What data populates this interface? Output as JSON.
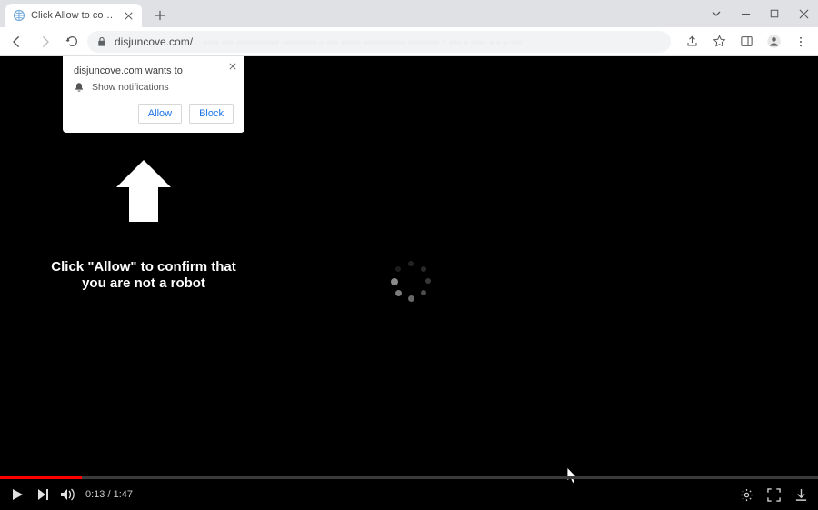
{
  "window": {
    "tab_title": "Click Allow to confirm that you a",
    "url_host": "disjuncove.com/",
    "url_tail_blur": "···· ··· ··········· ········· · ··· ····· ··········· ········ · ··· · ···· · · · ···"
  },
  "notification": {
    "title": "disjuncove.com wants to",
    "permission_text": "Show notifications",
    "allow_label": "Allow",
    "block_label": "Block"
  },
  "page": {
    "instruction_text": "Click \"Allow\" to confirm that you are not a robot"
  },
  "player": {
    "current_time": "0:13",
    "duration": "1:47",
    "time_display": "0:13 / 1:47"
  },
  "icons": {
    "favicon": "globe",
    "back": "back-arrow",
    "forward": "forward-arrow",
    "reload": "reload",
    "lock": "lock",
    "share": "share",
    "star": "star",
    "panel": "panel",
    "profile": "profile",
    "menu": "menu",
    "minimize": "minimize",
    "maximize": "maximize",
    "close": "close",
    "chevron": "chevron-down",
    "newtab": "plus",
    "bell": "bell",
    "play": "play",
    "next": "next",
    "volume": "volume",
    "gear": "gear",
    "fullscreen": "fullscreen",
    "download": "download"
  }
}
